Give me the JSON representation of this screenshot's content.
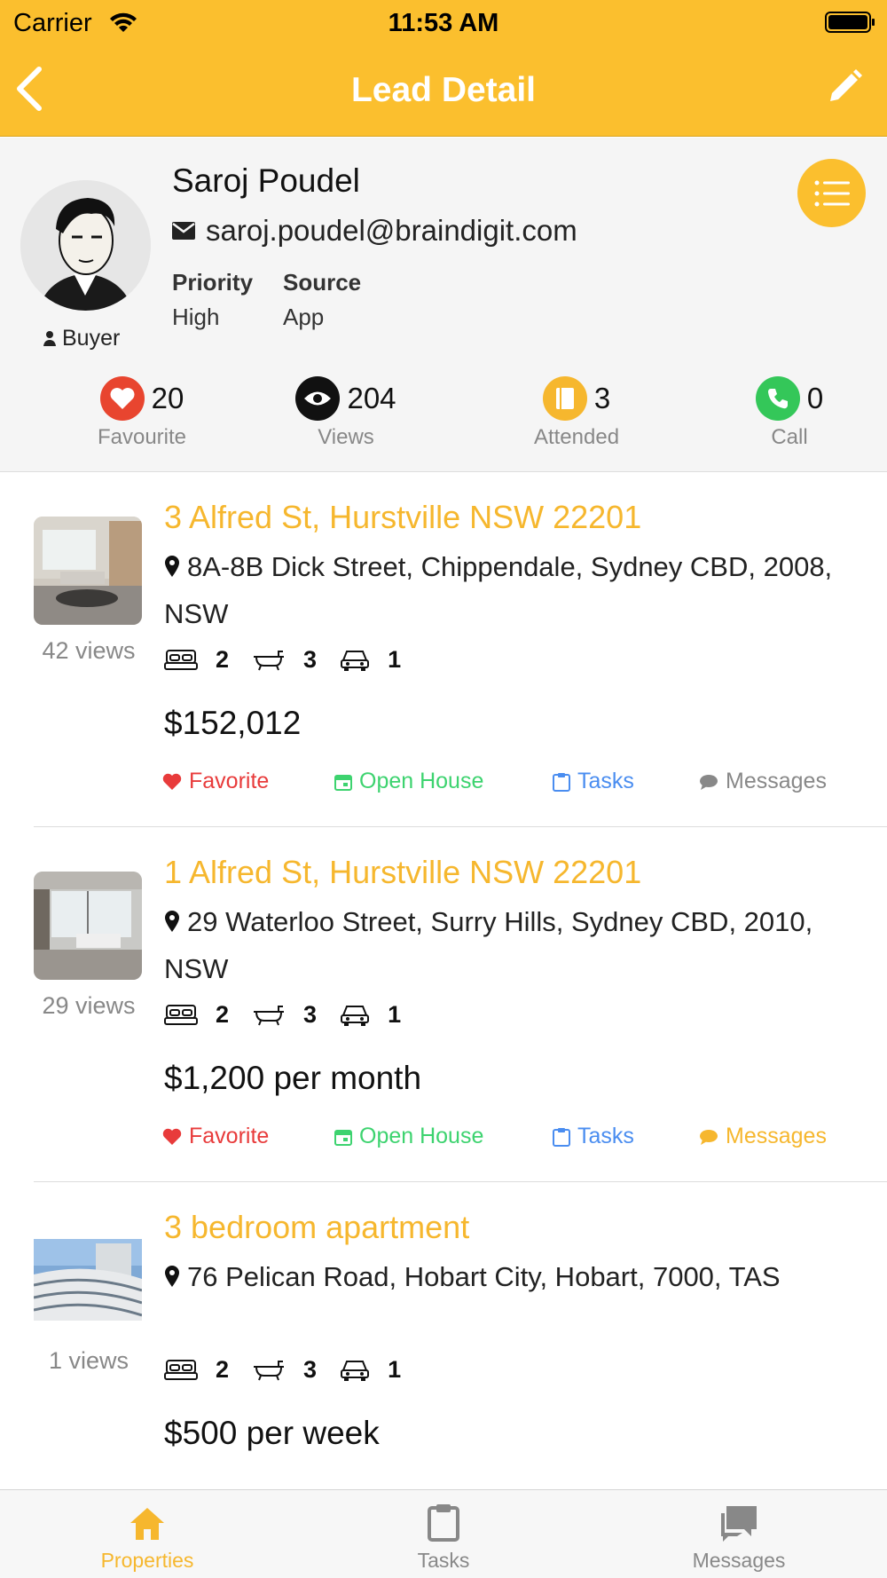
{
  "status_bar": {
    "carrier": "Carrier",
    "time": "11:53 AM"
  },
  "nav": {
    "title": "Lead Detail"
  },
  "profile": {
    "name": "Saroj Poudel",
    "email": "saroj.poudel@braindigit.com",
    "role": "Buyer",
    "priority_label": "Priority",
    "priority_value": "High",
    "source_label": "Source",
    "source_value": "App"
  },
  "stats": [
    {
      "value": "20",
      "label": "Favourite",
      "icon": "heart-icon",
      "color": "#E8452F"
    },
    {
      "value": "204",
      "label": "Views",
      "icon": "eye-icon",
      "color": "#111111"
    },
    {
      "value": "3",
      "label": "Attended",
      "icon": "book-icon",
      "color": "#F6B72E"
    },
    {
      "value": "0",
      "label": "Call",
      "icon": "phone-icon",
      "color": "#34C759"
    }
  ],
  "listings": [
    {
      "title": "3 Alfred St, Hurstville NSW 22201",
      "address": "8A-8B Dick Street, Chippendale, Sydney CBD, 2008, NSW",
      "views": "42 views",
      "beds": "2",
      "baths": "3",
      "cars": "1",
      "price": "$152,012",
      "actions": {
        "favorite": "Favorite",
        "open_house": "Open House",
        "tasks": "Tasks",
        "messages": "Messages"
      },
      "messages_color": "#888888"
    },
    {
      "title": "1 Alfred St, Hurstville NSW 22201",
      "address": "29 Waterloo Street, Surry Hills, Sydney CBD, 2010, NSW",
      "views": "29 views",
      "beds": "2",
      "baths": "3",
      "cars": "1",
      "price": "$1,200 per month",
      "actions": {
        "favorite": "Favorite",
        "open_house": "Open House",
        "tasks": "Tasks",
        "messages": "Messages"
      },
      "messages_color": "#F6B72E"
    },
    {
      "title": "3 bedroom apartment",
      "address": "76 Pelican Road, Hobart City, Hobart, 7000, TAS",
      "views": "1 views",
      "beds": "2",
      "baths": "3",
      "cars": "1",
      "price": "$500 per week"
    }
  ],
  "colors": {
    "accent": "#FBBF2E",
    "favorite": "#E83B3B",
    "open_house": "#3DD36F",
    "tasks": "#4A8DF0"
  },
  "tabs": [
    {
      "label": "Properties",
      "icon": "home-icon",
      "active": true
    },
    {
      "label": "Tasks",
      "icon": "clipboard-icon",
      "active": false
    },
    {
      "label": "Messages",
      "icon": "chat-icon",
      "active": false
    }
  ]
}
